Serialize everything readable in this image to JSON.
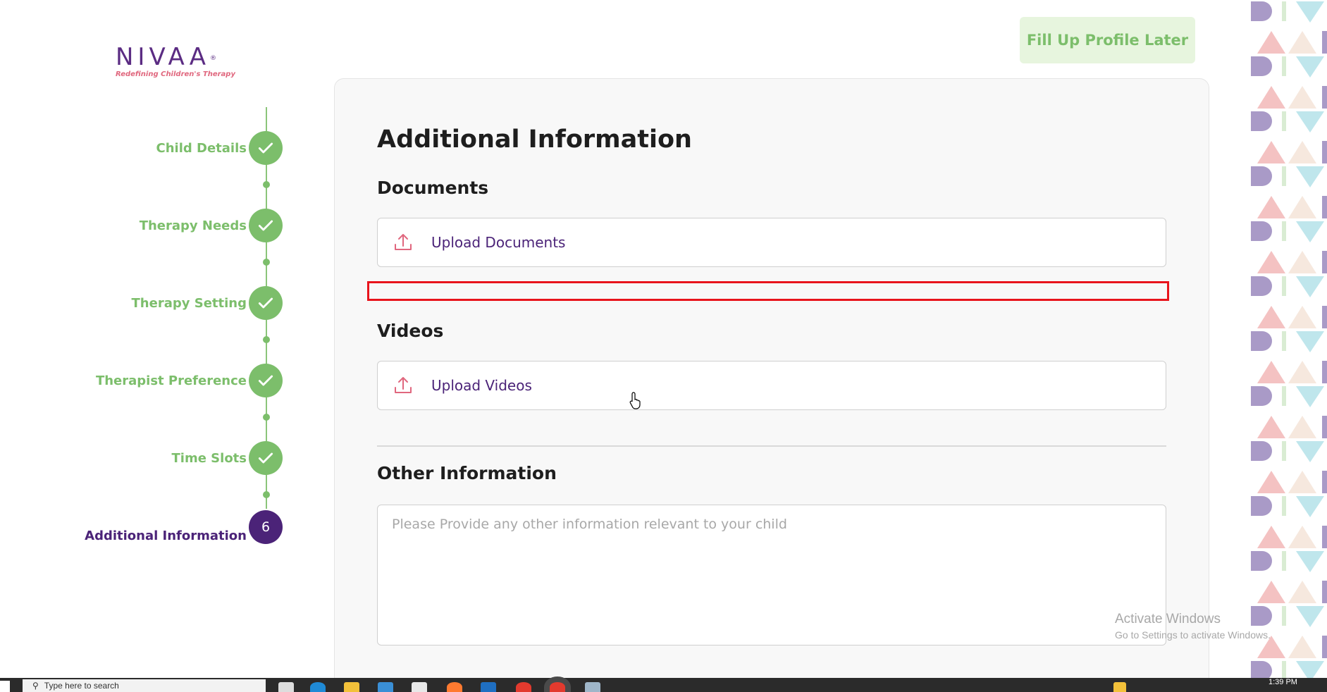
{
  "brand": {
    "name": "NIVAA",
    "tagline": "Redefining Children's Therapy",
    "primary_color": "#4b2378",
    "accent_color": "#7cbe6b",
    "logo_pink": "#e0677e"
  },
  "header": {
    "fill_later_label": "Fill Up Profile Later"
  },
  "stepper": {
    "steps": [
      {
        "label": "Child Details",
        "status": "complete"
      },
      {
        "label": "Therapy Needs",
        "status": "complete"
      },
      {
        "label": "Therapy Setting",
        "status": "complete"
      },
      {
        "label": "Therapist Preference",
        "status": "complete"
      },
      {
        "label": "Time Slots",
        "status": "complete"
      },
      {
        "label": "Additional Information",
        "status": "current",
        "number": "6"
      }
    ]
  },
  "form": {
    "title": "Additional Information",
    "documents": {
      "heading": "Documents",
      "upload_label": "Upload Documents"
    },
    "videos": {
      "heading": "Videos",
      "upload_label": "Upload Videos"
    },
    "other": {
      "heading": "Other Information",
      "placeholder": "Please Provide any other information relevant to your child",
      "value": ""
    }
  },
  "watermark": {
    "line1": "Activate Windows",
    "line2": "Go to Settings to activate Windows."
  },
  "taskbar": {
    "search_placeholder": "Type here to search",
    "clock": "1:39 PM"
  }
}
